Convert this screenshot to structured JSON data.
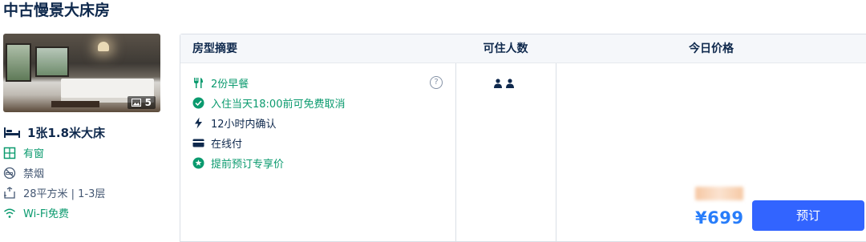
{
  "room_title": "中古慢景大床房",
  "photo": {
    "count": "5"
  },
  "bed_type": "1张1.8米大床",
  "features": [
    {
      "icon": "window-icon",
      "label": "有窗"
    },
    {
      "icon": "no-smoking-icon",
      "label": "禁烟"
    },
    {
      "icon": "area-icon",
      "label": "28平方米 | 1-3层"
    },
    {
      "icon": "wifi-icon",
      "label": "Wi-Fi免费"
    }
  ],
  "table": {
    "headers": [
      "房型摘要",
      "可住人数",
      "今日价格"
    ]
  },
  "policies": [
    {
      "icon": "fork-knife-icon",
      "label": "2份早餐"
    },
    {
      "icon": "check-circle-icon",
      "label": "入住当天18:00前可免费取消"
    },
    {
      "icon": "lightning-icon",
      "label": "12小时内确认"
    },
    {
      "icon": "card-icon",
      "label": "在线付"
    },
    {
      "icon": "star-circle-icon",
      "label": "提前预订专享价"
    }
  ],
  "help_label": "?",
  "occupancy": 2,
  "price": "¥699",
  "book_label": "预订",
  "colors": {
    "green": "#0a9a6e",
    "price_blue": "#287dfa",
    "button_blue": "#3264ff"
  }
}
